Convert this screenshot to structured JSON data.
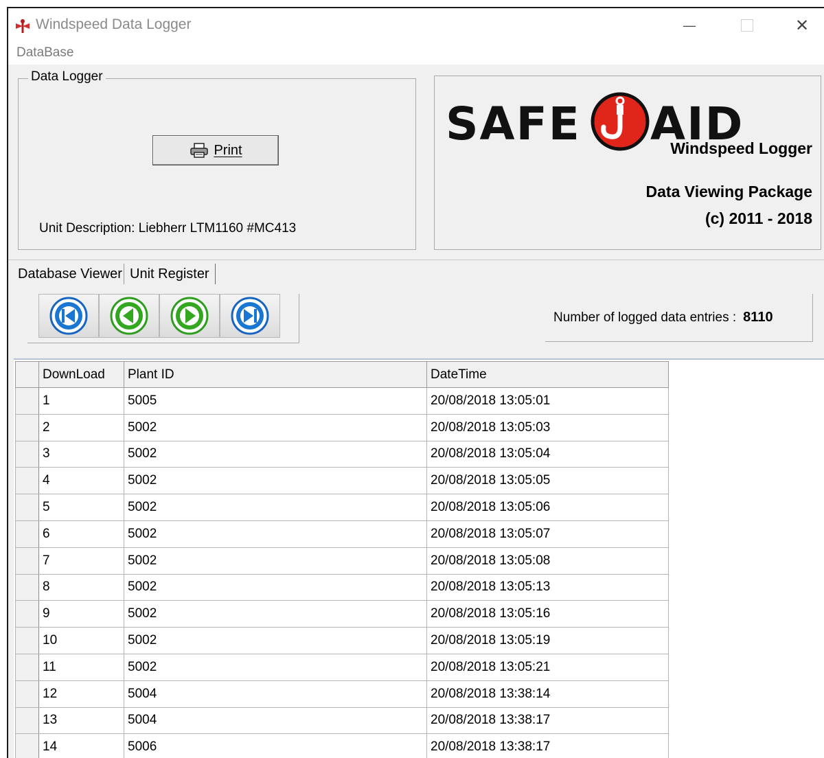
{
  "window": {
    "title": "Windspeed Data Logger",
    "minimize_symbol": "—",
    "close_symbol": "✕"
  },
  "menu": {
    "items": [
      {
        "label": "DataBase"
      }
    ]
  },
  "data_logger_group": {
    "legend": "Data Logger",
    "print_button": {
      "label": "Print",
      "icon": "printer-icon"
    },
    "unit_description_label": "Unit Description:",
    "unit_description_value": "Liebherr LTM1160 #MC413"
  },
  "branding": {
    "logo_text_left": "SAFE",
    "logo_text_right": "AID",
    "logo_icon": "crane-hook-icon",
    "product_name": "Windspeed Logger",
    "package_name": "Data Viewing Package",
    "copyright": "(c) 2011 - 2018"
  },
  "tabs": [
    {
      "label": "Database Viewer",
      "active": true
    },
    {
      "label": "Unit Register",
      "active": false
    }
  ],
  "navigation": {
    "buttons": [
      {
        "name": "first-record",
        "icon": "skip-first-icon",
        "color": "#1565c0"
      },
      {
        "name": "previous-record",
        "icon": "previous-icon",
        "color": "#2e9d1e"
      },
      {
        "name": "next-record",
        "icon": "next-icon",
        "color": "#2e9d1e"
      },
      {
        "name": "last-record",
        "icon": "skip-last-icon",
        "color": "#1565c0"
      }
    ]
  },
  "entry_count": {
    "label": "Number of logged data entries :",
    "value": "8110"
  },
  "grid": {
    "columns": [
      "DownLoad",
      "Plant ID",
      "DateTime"
    ],
    "rows": [
      [
        "1",
        "5005",
        "20/08/2018 13:05:01"
      ],
      [
        "2",
        "5002",
        "20/08/2018 13:05:03"
      ],
      [
        "3",
        "5002",
        "20/08/2018 13:05:04"
      ],
      [
        "4",
        "5002",
        "20/08/2018 13:05:05"
      ],
      [
        "5",
        "5002",
        "20/08/2018 13:05:06"
      ],
      [
        "6",
        "5002",
        "20/08/2018 13:05:07"
      ],
      [
        "7",
        "5002",
        "20/08/2018 13:05:08"
      ],
      [
        "8",
        "5002",
        "20/08/2018 13:05:13"
      ],
      [
        "9",
        "5002",
        "20/08/2018 13:05:16"
      ],
      [
        "10",
        "5002",
        "20/08/2018 13:05:19"
      ],
      [
        "11",
        "5002",
        "20/08/2018 13:05:21"
      ],
      [
        "12",
        "5004",
        "20/08/2018 13:38:14"
      ],
      [
        "13",
        "5004",
        "20/08/2018 13:38:17"
      ],
      [
        "14",
        "5006",
        "20/08/2018 13:38:17"
      ]
    ]
  },
  "colors": {
    "logo_red": "#e0251b",
    "nav_blue": "#1565c0",
    "nav_green": "#2e9d1e"
  }
}
